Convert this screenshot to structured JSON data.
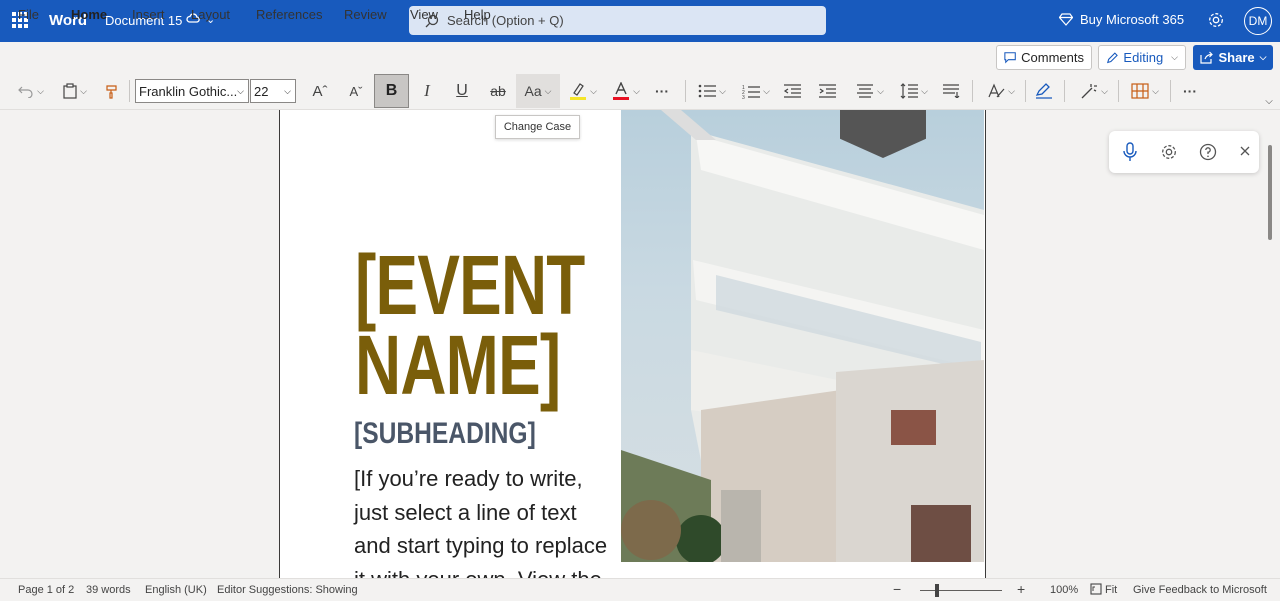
{
  "titlebar": {
    "app_name": "Word",
    "document_name": "Document 15",
    "search_placeholder": "Search (Option + Q)",
    "buy_label": "Buy Microsoft 365",
    "avatar_initials": "DM",
    "brand_color": "#185abd"
  },
  "menu": {
    "tabs": [
      "File",
      "Home",
      "Insert",
      "Layout",
      "References",
      "Review",
      "View",
      "Help"
    ],
    "active_tab": "Home",
    "comments_label": "Comments",
    "editing_label": "Editing",
    "share_label": "Share"
  },
  "ribbon": {
    "font_name": "Franklin Gothic...",
    "font_size": "22",
    "grow_font": "Aˆ",
    "shrink_font": "Aˇ",
    "bold": "B",
    "italic": "I",
    "underline": "U",
    "strike": "ab",
    "change_case": "Aa",
    "more": "···",
    "highlight_color": "#f5e52a",
    "font_color": "#e81123"
  },
  "tooltip": {
    "text": "Change Case"
  },
  "document": {
    "event_line1": "[EVENT",
    "event_line2": "NAME]",
    "subheading": "[SUBHEADING]",
    "body_lines": [
      "[If you’re ready to write,",
      "just select a line of text",
      "and start typing to replace",
      "it with your own. View the"
    ],
    "title_color": "#7a5e0a",
    "subheading_color": "#4a5668"
  },
  "statusbar": {
    "page": "Page 1 of 2",
    "words": "39 words",
    "language": "English (UK)",
    "editor": "Editor Suggestions: Showing",
    "zoom_out": "−",
    "zoom_in": "+",
    "zoom_level": "100%",
    "fit": "Fit",
    "feedback": "Give Feedback to Microsoft"
  }
}
